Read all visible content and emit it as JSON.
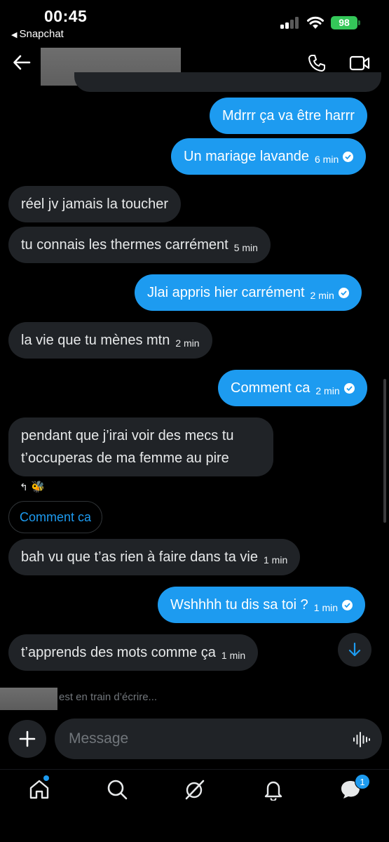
{
  "status_bar": {
    "time": "00:45",
    "back_app": "Snapchat",
    "battery": "98"
  },
  "header": {
    "contact_name": "",
    "icons": [
      "back-arrow-icon",
      "phone-icon",
      "video-call-icon"
    ]
  },
  "messages": [
    {
      "side": "sent",
      "text": "Mdrrr ça va être harrr",
      "time": ""
    },
    {
      "side": "sent",
      "text": "Un mariage lavande",
      "time": "6 min",
      "read": true
    },
    {
      "side": "received",
      "text": "réel jv jamais la toucher",
      "time": ""
    },
    {
      "side": "received",
      "text": "tu connais les thermes carrément",
      "time": "5 min"
    },
    {
      "side": "sent",
      "text": "Jlai appris hier carrément",
      "time": "2 min",
      "read": true
    },
    {
      "side": "received",
      "text": "la vie que tu mènes mtn",
      "time": "2 min"
    },
    {
      "side": "sent",
      "text": "Comment ca",
      "time": "2 min",
      "read": true
    },
    {
      "side": "received",
      "text_line1": "pendant que j’irai voir des mecs tu",
      "text_line2": "t’occuperas de ma femme au pire",
      "time": ""
    },
    {
      "side": "received",
      "text": "bah vu que t’as rien à faire dans ta vie",
      "time": "1 min"
    },
    {
      "side": "sent",
      "text": "Wshhhh tu dis sa toi ?",
      "time": "1 min",
      "read": true
    },
    {
      "side": "received",
      "text": "t’apprends des mots comme ça",
      "time": "1 min"
    }
  ],
  "reaction": {
    "icons": [
      "reply-icon",
      "bee-icon"
    ],
    "emoji": "🐝"
  },
  "reply_chip": "Comment ca",
  "typing_indicator": "est en train d’écrire...",
  "composer": {
    "placeholder": "Message"
  },
  "nav": {
    "items": [
      "home-icon",
      "search-icon",
      "grok-icon",
      "notifications-icon",
      "messages-icon"
    ],
    "messages_badge": "1"
  },
  "colors": {
    "accent": "#1d9bf0",
    "received_bubble": "#202327",
    "background": "#000000",
    "battery": "#34c759"
  }
}
